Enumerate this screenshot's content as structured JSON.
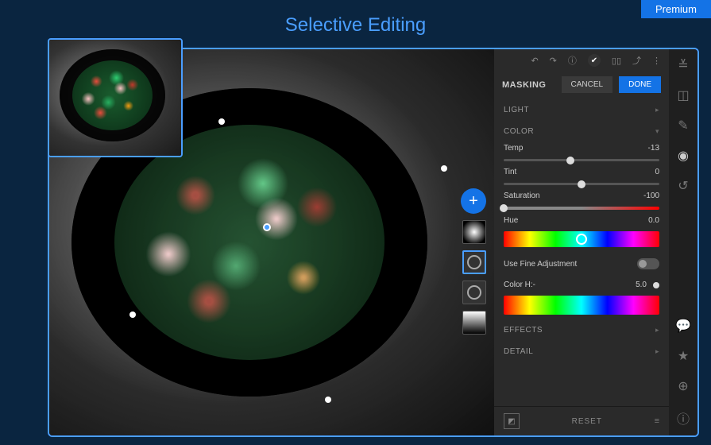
{
  "premium_label": "Premium",
  "page_title": "Selective Editing",
  "toolbar": {
    "undo_icon": "↶",
    "redo_icon": "↷",
    "info_icon": "ⓘ",
    "check_icon": "✔",
    "compare_icon": "▯▯",
    "share_icon": "⤴",
    "more_icon": "⋮"
  },
  "masking": {
    "label": "MASKING",
    "cancel": "CANCEL",
    "done": "DONE"
  },
  "sections": {
    "light": "LIGHT",
    "color": "COLOR",
    "effects": "EFFECTS",
    "detail": "DETAIL"
  },
  "sliders": {
    "temp": {
      "label": "Temp",
      "value": "-13",
      "pos": 43
    },
    "tint": {
      "label": "Tint",
      "value": "0",
      "pos": 50
    },
    "saturation": {
      "label": "Saturation",
      "value": "-100",
      "pos": 0
    },
    "hue": {
      "label": "Hue",
      "value": "0.0",
      "pos": 50
    }
  },
  "fine_adjust": {
    "label": "Use Fine Adjustment"
  },
  "color_hue": {
    "label": "Color  H:-",
    "value": "5.0"
  },
  "bottom": {
    "reset": "RESET"
  },
  "add_label": "+"
}
